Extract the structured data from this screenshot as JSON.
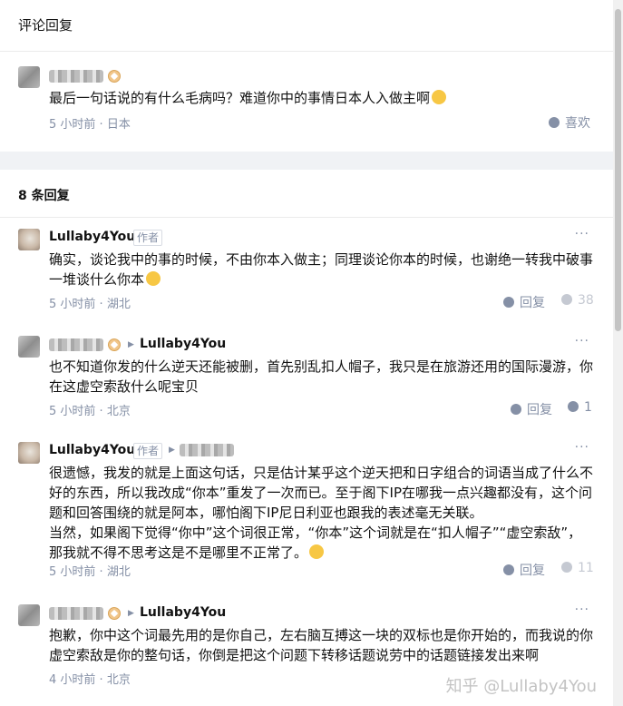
{
  "header": {
    "title": "评论回复"
  },
  "top_comment": {
    "text": "最后一句话说的有什么毛病吗？难道你中的事情日本人入做主啊",
    "time": "5 小时前",
    "location": "日本",
    "like_label": "喜欢"
  },
  "replies": {
    "count_label": "8 条回复",
    "items": [
      {
        "author": "Lullaby4You",
        "author_tag": "作者",
        "text": "确实，谈论我中的事的时候，不由你本入做主；同理谈论你本的时候，也谢绝一转我中破事一堆谈什么你本",
        "time": "5 小时前",
        "location": "湖北",
        "reply_label": "回复",
        "likes": "38"
      },
      {
        "reply_to": "Lullaby4You",
        "text": "也不知道你发的什么逆天还能被删，首先别乱扣人帽子，我只是在旅游还用的国际漫游，你在这虚空索敌什么呢宝贝",
        "time": "5 小时前",
        "location": "北京",
        "reply_label": "回复",
        "likes": "1"
      },
      {
        "author": "Lullaby4You",
        "author_tag": "作者",
        "text": "很遗憾，我发的就是上面这句话，只是估计某乎这个逆天把和日字组合的词语当成了什么不好的东西，所以我改成“你本”重发了一次而已。至于阁下IP在哪我一点兴趣都没有，这个问题和回答围绕的就是阿本，哪怕阁下IP尼日利亚也跟我的表述毫无关联。\n当然，如果阁下觉得“你中”这个词很正常，“你本”这个词就是在“扣人帽子”“虚空索敌”，那我就不得不思考这是不是哪里不正常了。",
        "time": "5 小时前",
        "location": "湖北",
        "reply_label": "回复",
        "likes": "11"
      },
      {
        "reply_to": "Lullaby4You",
        "text": "抱歉，你中这个词最先用的是你自己，左右脑互搏这一块的双标也是你开始的，而我说的你虚空索敌是你的整句话，你倒是把这个问题下转移话题说劳中的话题链接发出来啊",
        "time": "4 小时前",
        "location": "北京"
      }
    ]
  },
  "more_label": "···",
  "watermark": "知乎 @Lullaby4You"
}
